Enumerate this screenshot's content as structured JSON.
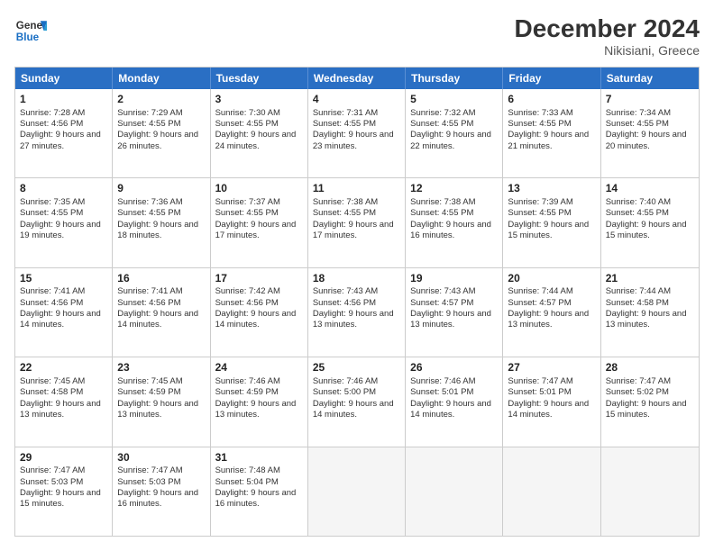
{
  "header": {
    "logo_line1": "General",
    "logo_line2": "Blue",
    "title": "December 2024",
    "subtitle": "Nikisiani, Greece"
  },
  "days": [
    "Sunday",
    "Monday",
    "Tuesday",
    "Wednesday",
    "Thursday",
    "Friday",
    "Saturday"
  ],
  "weeks": [
    [
      {
        "num": "1",
        "sunrise": "7:28 AM",
        "sunset": "4:56 PM",
        "daylight": "9 hours and 27 minutes."
      },
      {
        "num": "2",
        "sunrise": "7:29 AM",
        "sunset": "4:55 PM",
        "daylight": "9 hours and 26 minutes."
      },
      {
        "num": "3",
        "sunrise": "7:30 AM",
        "sunset": "4:55 PM",
        "daylight": "9 hours and 24 minutes."
      },
      {
        "num": "4",
        "sunrise": "7:31 AM",
        "sunset": "4:55 PM",
        "daylight": "9 hours and 23 minutes."
      },
      {
        "num": "5",
        "sunrise": "7:32 AM",
        "sunset": "4:55 PM",
        "daylight": "9 hours and 22 minutes."
      },
      {
        "num": "6",
        "sunrise": "7:33 AM",
        "sunset": "4:55 PM",
        "daylight": "9 hours and 21 minutes."
      },
      {
        "num": "7",
        "sunrise": "7:34 AM",
        "sunset": "4:55 PM",
        "daylight": "9 hours and 20 minutes."
      }
    ],
    [
      {
        "num": "8",
        "sunrise": "7:35 AM",
        "sunset": "4:55 PM",
        "daylight": "9 hours and 19 minutes."
      },
      {
        "num": "9",
        "sunrise": "7:36 AM",
        "sunset": "4:55 PM",
        "daylight": "9 hours and 18 minutes."
      },
      {
        "num": "10",
        "sunrise": "7:37 AM",
        "sunset": "4:55 PM",
        "daylight": "9 hours and 17 minutes."
      },
      {
        "num": "11",
        "sunrise": "7:38 AM",
        "sunset": "4:55 PM",
        "daylight": "9 hours and 17 minutes."
      },
      {
        "num": "12",
        "sunrise": "7:38 AM",
        "sunset": "4:55 PM",
        "daylight": "9 hours and 16 minutes."
      },
      {
        "num": "13",
        "sunrise": "7:39 AM",
        "sunset": "4:55 PM",
        "daylight": "9 hours and 15 minutes."
      },
      {
        "num": "14",
        "sunrise": "7:40 AM",
        "sunset": "4:55 PM",
        "daylight": "9 hours and 15 minutes."
      }
    ],
    [
      {
        "num": "15",
        "sunrise": "7:41 AM",
        "sunset": "4:56 PM",
        "daylight": "9 hours and 14 minutes."
      },
      {
        "num": "16",
        "sunrise": "7:41 AM",
        "sunset": "4:56 PM",
        "daylight": "9 hours and 14 minutes."
      },
      {
        "num": "17",
        "sunrise": "7:42 AM",
        "sunset": "4:56 PM",
        "daylight": "9 hours and 14 minutes."
      },
      {
        "num": "18",
        "sunrise": "7:43 AM",
        "sunset": "4:56 PM",
        "daylight": "9 hours and 13 minutes."
      },
      {
        "num": "19",
        "sunrise": "7:43 AM",
        "sunset": "4:57 PM",
        "daylight": "9 hours and 13 minutes."
      },
      {
        "num": "20",
        "sunrise": "7:44 AM",
        "sunset": "4:57 PM",
        "daylight": "9 hours and 13 minutes."
      },
      {
        "num": "21",
        "sunrise": "7:44 AM",
        "sunset": "4:58 PM",
        "daylight": "9 hours and 13 minutes."
      }
    ],
    [
      {
        "num": "22",
        "sunrise": "7:45 AM",
        "sunset": "4:58 PM",
        "daylight": "9 hours and 13 minutes."
      },
      {
        "num": "23",
        "sunrise": "7:45 AM",
        "sunset": "4:59 PM",
        "daylight": "9 hours and 13 minutes."
      },
      {
        "num": "24",
        "sunrise": "7:46 AM",
        "sunset": "4:59 PM",
        "daylight": "9 hours and 13 minutes."
      },
      {
        "num": "25",
        "sunrise": "7:46 AM",
        "sunset": "5:00 PM",
        "daylight": "9 hours and 14 minutes."
      },
      {
        "num": "26",
        "sunrise": "7:46 AM",
        "sunset": "5:01 PM",
        "daylight": "9 hours and 14 minutes."
      },
      {
        "num": "27",
        "sunrise": "7:47 AM",
        "sunset": "5:01 PM",
        "daylight": "9 hours and 14 minutes."
      },
      {
        "num": "28",
        "sunrise": "7:47 AM",
        "sunset": "5:02 PM",
        "daylight": "9 hours and 15 minutes."
      }
    ],
    [
      {
        "num": "29",
        "sunrise": "7:47 AM",
        "sunset": "5:03 PM",
        "daylight": "9 hours and 15 minutes."
      },
      {
        "num": "30",
        "sunrise": "7:47 AM",
        "sunset": "5:03 PM",
        "daylight": "9 hours and 16 minutes."
      },
      {
        "num": "31",
        "sunrise": "7:48 AM",
        "sunset": "5:04 PM",
        "daylight": "9 hours and 16 minutes."
      },
      null,
      null,
      null,
      null
    ]
  ],
  "labels": {
    "sunrise": "Sunrise:",
    "sunset": "Sunset:",
    "daylight": "Daylight:"
  }
}
